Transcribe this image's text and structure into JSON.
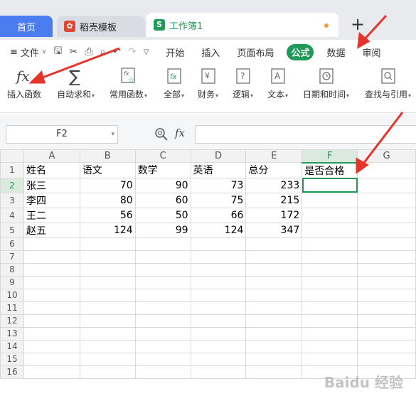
{
  "tabs": {
    "home": "首页",
    "templates": "稻壳模板",
    "workbook": "工作簿1",
    "new_tab": "+"
  },
  "menu": {
    "file": "文件",
    "items": [
      "开始",
      "插入",
      "页面布局",
      "公式",
      "数据",
      "审阅"
    ],
    "active": "公式"
  },
  "ribbon": {
    "buttons": [
      {
        "label": "插入函数",
        "icon": "fx-icon"
      },
      {
        "label": "自动求和",
        "icon": "sigma-icon",
        "dropdown": true
      },
      {
        "label": "常用函数",
        "icon": "star-fx-icon",
        "dropdown": true
      },
      {
        "label": "全部",
        "icon": "fx-box-icon",
        "dropdown": true
      },
      {
        "label": "财务",
        "icon": "finance-icon",
        "dropdown": true
      },
      {
        "label": "逻辑",
        "icon": "logic-icon",
        "dropdown": true
      },
      {
        "label": "文本",
        "icon": "text-icon",
        "dropdown": true
      },
      {
        "label": "日期和时间",
        "icon": "clock-icon",
        "dropdown": true
      },
      {
        "label": "查找与引用",
        "icon": "search-doc-icon",
        "dropdown": true
      }
    ]
  },
  "formula_bar": {
    "name_box": "F2",
    "fx": "fx",
    "value": ""
  },
  "sheet": {
    "columns": [
      "A",
      "B",
      "C",
      "D",
      "E",
      "F",
      "G"
    ],
    "selected_column": "F",
    "selected_row": 2,
    "active_cell": "F2",
    "rows": [
      [
        "姓名",
        "语文",
        "数学",
        "英语",
        "总分",
        "是否合格",
        ""
      ],
      [
        "张三",
        "70",
        "90",
        "73",
        "233",
        "",
        ""
      ],
      [
        "李四",
        "80",
        "60",
        "75",
        "215",
        "",
        ""
      ],
      [
        "王二",
        "56",
        "50",
        "66",
        "172",
        "",
        ""
      ],
      [
        "赵五",
        "124",
        "99",
        "124",
        "347",
        "",
        ""
      ],
      [
        "",
        "",
        "",
        "",
        "",
        "",
        ""
      ],
      [
        "",
        "",
        "",
        "",
        "",
        "",
        ""
      ],
      [
        "",
        "",
        "",
        "",
        "",
        "",
        ""
      ],
      [
        "",
        "",
        "",
        "",
        "",
        "",
        ""
      ],
      [
        "",
        "",
        "",
        "",
        "",
        "",
        ""
      ],
      [
        "",
        "",
        "",
        "",
        "",
        "",
        ""
      ],
      [
        "",
        "",
        "",
        "",
        "",
        "",
        ""
      ],
      [
        "",
        "",
        "",
        "",
        "",
        "",
        ""
      ],
      [
        "",
        "",
        "",
        "",
        "",
        "",
        ""
      ],
      [
        "",
        "",
        "",
        "",
        "",
        "",
        ""
      ],
      [
        "",
        "",
        "",
        "",
        "",
        "",
        ""
      ]
    ]
  },
  "watermark": "Baidu 经验",
  "colors": {
    "accent": "#1f9a58",
    "home_tab": "#4c7df0",
    "arrow": "#e8332a"
  }
}
